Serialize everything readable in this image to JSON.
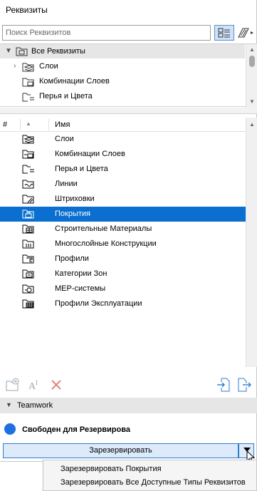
{
  "window": {
    "title": "Реквизиты"
  },
  "search": {
    "placeholder": "Поиск Реквизитов"
  },
  "tree": {
    "root": "Все Реквизиты",
    "items": [
      {
        "label": "Слои",
        "icon": "layers-folder-icon"
      },
      {
        "label": "Комбинации Слоев",
        "icon": "layer-combinations-icon"
      },
      {
        "label": "Перья и Цвета",
        "icon": "pens-colors-icon"
      }
    ]
  },
  "list": {
    "columns": {
      "number": "#",
      "name": "Имя"
    },
    "rows": [
      {
        "label": "Слои",
        "icon": "layers-icon",
        "selected": false
      },
      {
        "label": "Комбинации Слоев",
        "icon": "layer-combinations-icon",
        "selected": false
      },
      {
        "label": "Перья и Цвета",
        "icon": "pens-colors-icon",
        "selected": false
      },
      {
        "label": "Линии",
        "icon": "line-types-icon",
        "selected": false
      },
      {
        "label": "Штриховки",
        "icon": "fills-icon",
        "selected": false
      },
      {
        "label": "Покрытия",
        "icon": "surfaces-icon",
        "selected": true
      },
      {
        "label": "Строительные Материалы",
        "icon": "building-materials-icon",
        "selected": false
      },
      {
        "label": "Многослойные Конструкции",
        "icon": "composites-icon",
        "selected": false
      },
      {
        "label": "Профили",
        "icon": "profiles-icon",
        "selected": false
      },
      {
        "label": "Категории Зон",
        "icon": "zone-categories-icon",
        "selected": false
      },
      {
        "label": "MEP-системы",
        "icon": "mep-systems-icon",
        "selected": false
      },
      {
        "label": "Профили Эксплуатации",
        "icon": "operation-profiles-icon",
        "selected": false
      }
    ]
  },
  "toolbar": {
    "new": "new-attribute-icon",
    "rename": "rename-icon",
    "delete": "delete-icon",
    "import": "import-icon",
    "export": "export-icon"
  },
  "teamwork": {
    "section_label": "Teamwork",
    "status_label": "Свободен для Резервирова",
    "reserve_button": "Зарезервировать"
  },
  "dropdown_menu": {
    "items": [
      "Зарезервировать Покрытия",
      "Зарезервировать Все Доступные Типы Реквизитов"
    ]
  },
  "colors": {
    "selection": "#0a6fd1",
    "accent": "#2e7cd2",
    "status_dot": "#1f6fe0",
    "delete": "#d9534f"
  }
}
